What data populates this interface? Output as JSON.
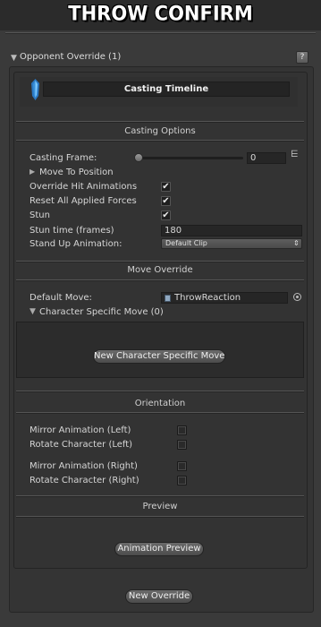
{
  "banner_title": "THROW CONFIRM",
  "foldout": {
    "arrow": "▼",
    "label": "Opponent Override (1)",
    "help": "?"
  },
  "timeline": {
    "label": "Casting Timeline"
  },
  "casting_options": {
    "title": "Casting Options",
    "casting_frame": {
      "label": "Casting Frame:",
      "value": "0",
      "slider_fraction": 0
    },
    "move_to_position": {
      "arrow": "▶",
      "label": "Move To Position"
    },
    "override_hit_animations": {
      "label": "Override Hit Animations",
      "checked": true
    },
    "reset_forces": {
      "label": "Reset All Applied Forces",
      "checked": true
    },
    "stun": {
      "label": "Stun",
      "checked": true
    },
    "stun_time": {
      "label": "Stun time (frames)",
      "value": "180"
    },
    "stand_up": {
      "label": "Stand Up Animation:",
      "value": "Default Clip",
      "arrow": "⇕"
    }
  },
  "move_override": {
    "title": "Move Override",
    "default_move": {
      "label": "Default Move:",
      "value": "ThrowReaction"
    },
    "char_specific": {
      "arrow": "▼",
      "label": "Character Specific Move (0)"
    },
    "new_button": "New Character Specific Move"
  },
  "orientation": {
    "title": "Orientation",
    "mirror_left": {
      "label": "Mirror Animation (Left)",
      "checked": false
    },
    "rotate_left": {
      "label": "Rotate Character (Left)",
      "checked": false
    },
    "mirror_right": {
      "label": "Mirror Animation (Right)",
      "checked": false
    },
    "rotate_right": {
      "label": "Rotate Character (Right)",
      "checked": false
    }
  },
  "preview": {
    "title": "Preview",
    "button": "Animation Preview"
  },
  "new_override_button": "New Override",
  "check_glyph": "✔",
  "menu_glyph": "⋿",
  "colors": {
    "background": "#3a3a3a",
    "panel": "#333333",
    "field": "#262626",
    "button": "#5a5a5a",
    "crystal": "#5ab0f0"
  }
}
